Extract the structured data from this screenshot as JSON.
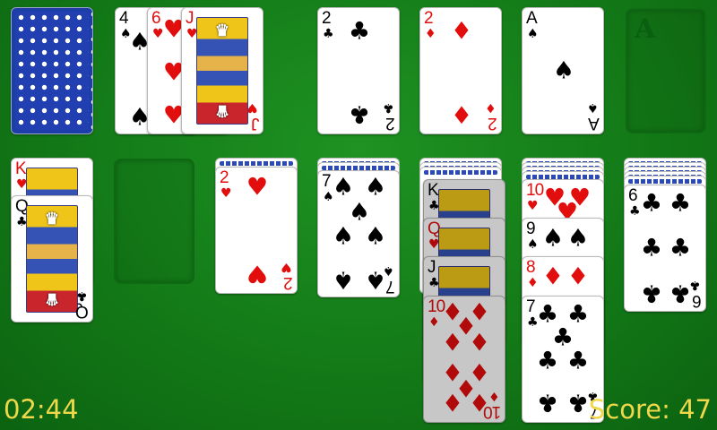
{
  "game": {
    "timer": "02:44",
    "score": "Score: 47",
    "foundation_empty_letter": "A"
  },
  "colors": {
    "felt": "#137a17",
    "red": "#e20d0d",
    "black": "#000000",
    "text": "#f1d84b"
  },
  "waste": [
    {
      "rank": "4",
      "suit": "♠"
    },
    {
      "rank": "6",
      "suit": "♥"
    },
    {
      "rank": "J",
      "suit": "♥"
    }
  ],
  "foundations": [
    {
      "rank": "2",
      "suit": "♣"
    },
    {
      "rank": "2",
      "suit": "♦"
    },
    {
      "rank": "A",
      "suit": "♠"
    }
  ],
  "tableau": {
    "col1": [
      {
        "rank": "K",
        "suit": "♥"
      },
      {
        "rank": "Q",
        "suit": "♣"
      }
    ],
    "col3": [
      {
        "rank": "2",
        "suit": "♥"
      }
    ],
    "col4": [
      {
        "rank": "7",
        "suit": "♠"
      }
    ],
    "col5": [
      {
        "rank": "K",
        "suit": "♣"
      },
      {
        "rank": "Q",
        "suit": "♥"
      },
      {
        "rank": "J",
        "suit": "♣"
      },
      {
        "rank": "10",
        "suit": "♦"
      }
    ],
    "col6": [
      {
        "rank": "10",
        "suit": "♥"
      },
      {
        "rank": "9",
        "suit": "♠"
      },
      {
        "rank": "8",
        "suit": "♦"
      },
      {
        "rank": "7",
        "suit": "♣"
      }
    ],
    "col7": [
      {
        "rank": "6",
        "suit": "♣"
      }
    ]
  }
}
